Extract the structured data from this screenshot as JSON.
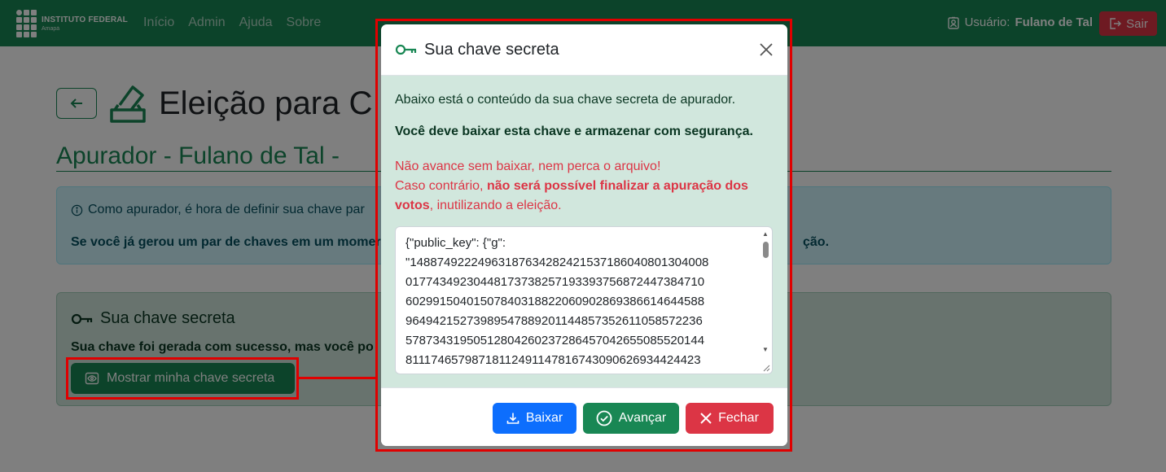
{
  "navbar": {
    "brand_title": "INSTITUTO FEDERAL",
    "brand_sub": "Amapá",
    "links": [
      "Início",
      "Admin",
      "Ajuda",
      "Sobre"
    ],
    "user_label": "Usuário:",
    "user_name": "Fulano de Tal",
    "logout_label": "Sair"
  },
  "page": {
    "title": "Eleição para C",
    "subtitle": "Apurador - Fulano de Tal -",
    "info_line1": "Como apurador, é hora de definir sua chave par",
    "info_line2": "Se você já gerou um par de chaves em um momer",
    "info_line2_tail": "ção.",
    "card_title": "Sua chave secreta",
    "card_text": "Sua chave foi gerada com sucesso, mas você po",
    "show_button": "Mostrar minha chave secreta"
  },
  "modal": {
    "title": "Sua chave secreta",
    "p1": "Abaixo está o conteúdo da sua chave secreta de apurador.",
    "p2": "Você deve baixar esta chave e armazenar com segurança.",
    "p3_line1": "Não avance sem baixar, nem perca o arquivo!",
    "p3_prefix": "Caso contrário, ",
    "p3_bold": "não será possível finalizar a apuração dos votos",
    "p3_suffix": ", inutilizando a eleição.",
    "key_content": "{\"public_key\": {\"g\":\n\"14887492224963187634282421537186040801304008\n01774349230448173738257193393756872447384710\n60299150401507840318822060902869386614644588\n96494215273989547889201144857352611058572236\n57873431950512804260237286457042655085520144\n81117465798718112491147816743090626934424423",
    "download_label": "Baixar",
    "advance_label": "Avançar",
    "close_label": "Fechar"
  },
  "colors": {
    "primary_green": "#198754",
    "info_bg": "#cff4fc",
    "success_bg": "#d1e7dd",
    "danger": "#dc3545",
    "blue": "#0d6efd",
    "highlight_red": "#e00000"
  }
}
